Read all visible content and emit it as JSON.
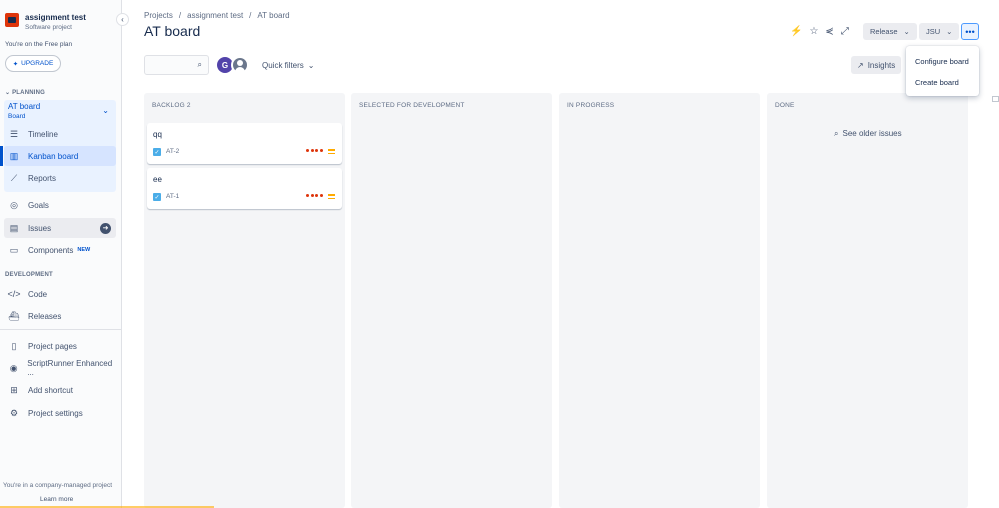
{
  "project": {
    "name": "assignment test",
    "type": "Software project",
    "plan_text": "You're on the Free plan",
    "upgrade_label": "UPGRADE"
  },
  "sidebar": {
    "planning_label": "PLANNING",
    "board": {
      "name": "AT board",
      "subtitle": "Board"
    },
    "planning_items": [
      {
        "label": "Timeline",
        "icon": "timeline-icon"
      },
      {
        "label": "Kanban board",
        "icon": "kanban-icon",
        "active": true
      },
      {
        "label": "Reports",
        "icon": "reports-icon"
      }
    ],
    "goals_label": "Goals",
    "issues_label": "Issues",
    "components_label": "Components",
    "components_badge": "NEW",
    "development_label": "DEVELOPMENT",
    "development_items": [
      {
        "label": "Code",
        "icon": "code-icon"
      },
      {
        "label": "Releases",
        "icon": "releases-icon"
      }
    ],
    "extra_items": [
      {
        "label": "Project pages",
        "icon": "page-icon"
      },
      {
        "label": "ScriptRunner Enhanced ...",
        "icon": "scriptrunner-icon"
      },
      {
        "label": "Add shortcut",
        "icon": "add-shortcut-icon"
      },
      {
        "label": "Project settings",
        "icon": "settings-icon"
      }
    ],
    "footer_note": "You're in a company-managed project",
    "learn_more": "Learn more"
  },
  "header": {
    "breadcrumbs": [
      "Projects",
      "assignment test",
      "AT board"
    ],
    "title": "AT board",
    "release_label": "Release",
    "jsu_label": "JSU"
  },
  "menu": {
    "items": [
      "Configure board",
      "Create board"
    ]
  },
  "filters": {
    "search_placeholder": "",
    "avatar_initial": "G",
    "quick_filters_label": "Quick filters",
    "insights_label": "Insights"
  },
  "board": {
    "columns": [
      {
        "title": "BACKLOG 2"
      },
      {
        "title": "SELECTED FOR DEVELOPMENT"
      },
      {
        "title": "IN PROGRESS"
      },
      {
        "title": "DONE"
      }
    ],
    "cards": [
      {
        "summary": "qq",
        "key": "AT-2",
        "priority": "medium"
      },
      {
        "summary": "ee",
        "key": "AT-1",
        "priority": "medium"
      }
    ],
    "older_issues_label": "See older issues"
  },
  "colors": {
    "accent": "#0052cc",
    "priority_medium": "#ffab00",
    "dots": "#de350b",
    "avatar_g": "#5243aa"
  }
}
